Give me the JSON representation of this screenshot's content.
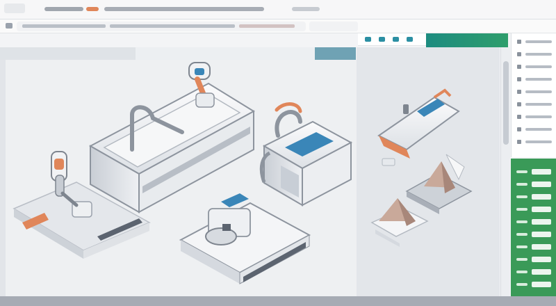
{
  "colors": {
    "accent_teal": "#1d8c80",
    "accent_green": "#3a9a58",
    "accent_orange": "#e0865a",
    "accent_blue": "#3a86b8",
    "device_body": "#f4f5f7",
    "device_outline": "#8d949e"
  },
  "icons": {
    "address_icon": "page-icon",
    "panel_tabs": [
      "layers-icon",
      "grid-icon",
      "camera-icon",
      "settings-icon"
    ]
  }
}
